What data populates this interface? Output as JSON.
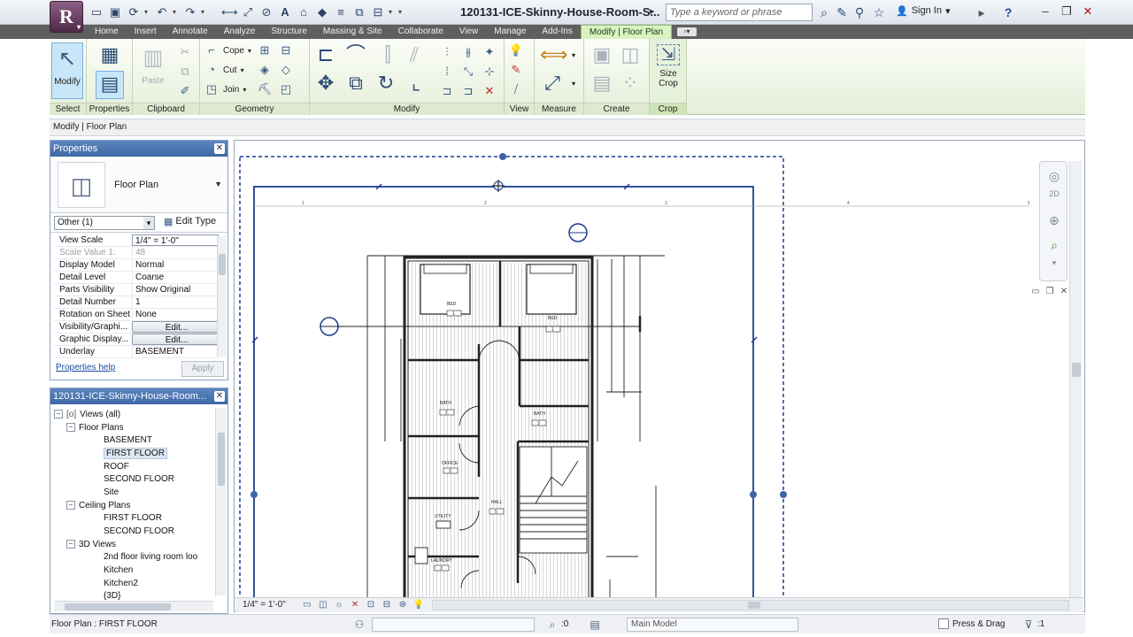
{
  "titlebar": {
    "app_button": "R",
    "doc_title": "120131-ICE-Skinny-House-Room-S...",
    "more": "▸",
    "search_placeholder": "Type a keyword or phrase",
    "signin": "Sign In",
    "help": "?"
  },
  "ribbon_tabs": [
    "Home",
    "Insert",
    "Annotate",
    "Analyze",
    "Structure",
    "Massing & Site",
    "Collaborate",
    "View",
    "Manage",
    "Add-Ins"
  ],
  "ribbon_active_tab": "Modify | Floor Plan",
  "ribbon": {
    "select": {
      "modify_label": "Modify",
      "panel": "Select"
    },
    "properties": {
      "panel": "Properties"
    },
    "clipboard": {
      "paste_label": "Paste",
      "panel": "Clipboard"
    },
    "geometry": {
      "cope": "Cope",
      "cut": "Cut",
      "join": "Join",
      "panel": "Geometry"
    },
    "modify": {
      "panel": "Modify"
    },
    "view": {
      "panel": "View"
    },
    "measure": {
      "panel": "Measure"
    },
    "create": {
      "panel": "Create"
    },
    "crop": {
      "size_crop": "Size Crop",
      "panel": "Crop"
    }
  },
  "options_bar": {
    "text": "Modify | Floor Plan"
  },
  "properties": {
    "title": "Properties",
    "type_name": "Floor Plan",
    "filter": "Other (1)",
    "edit_type": "Edit Type",
    "rows": [
      {
        "name": "View Scale",
        "value": "1/4\" = 1'-0\""
      },
      {
        "name": "Scale Value    1:",
        "value": "48"
      },
      {
        "name": "Display Model",
        "value": "Normal"
      },
      {
        "name": "Detail Level",
        "value": "Coarse"
      },
      {
        "name": "Parts Visibility",
        "value": "Show Original"
      },
      {
        "name": "Detail Number",
        "value": "1"
      },
      {
        "name": "Rotation on Sheet",
        "value": "None"
      },
      {
        "name": "Visibility/Graphi...",
        "value": "Edit..."
      },
      {
        "name": "Graphic Display...",
        "value": "Edit..."
      },
      {
        "name": "Underlay",
        "value": "BASEMENT"
      }
    ],
    "help_link": "Properties help",
    "apply": "Apply"
  },
  "browser": {
    "title": "120131-ICE-Skinny-House-Room...",
    "root": "Views (all)",
    "floor_plans": "Floor Plans",
    "fp_items": [
      "BASEMENT",
      "FIRST FLOOR",
      "ROOF",
      "SECOND FLOOR",
      "Site"
    ],
    "ceiling_plans": "Ceiling Plans",
    "cp_items": [
      "FIRST FLOOR",
      "SECOND FLOOR"
    ],
    "views_3d": "3D Views",
    "v3d_items": [
      "2nd floor living room loo",
      "Kitchen",
      "Kitchen2",
      "{3D}"
    ]
  },
  "plan": {
    "rooms": [
      {
        "name": "BED",
        "number": "1"
      },
      {
        "name": "BED",
        "number": "1"
      },
      {
        "name": "BATH",
        "number": "2"
      },
      {
        "name": "BATH",
        "number": "3"
      },
      {
        "name": "OFFICE",
        "number": "3"
      },
      {
        "name": "HALL",
        "number": "5"
      },
      {
        "name": "UTILITY",
        "number": "7"
      },
      {
        "name": "LAUNDRY",
        "number": "3"
      }
    ],
    "grid_ticks": [
      "1",
      "2",
      "3",
      "4",
      "5"
    ]
  },
  "view_bar": {
    "scale": "1/4\" = 1'-0\""
  },
  "status": {
    "text": "Floor Plan : FIRST FLOOR",
    "select_count": ":0",
    "model": "Main Model",
    "press_drag": "Press & Drag",
    "filter_count": ":1"
  },
  "colors": {
    "active_tab": "#d9f2c2",
    "panel_header": "#4a74b0",
    "crop_region": "#1f3f8f",
    "app_button": "#6b3a63"
  }
}
